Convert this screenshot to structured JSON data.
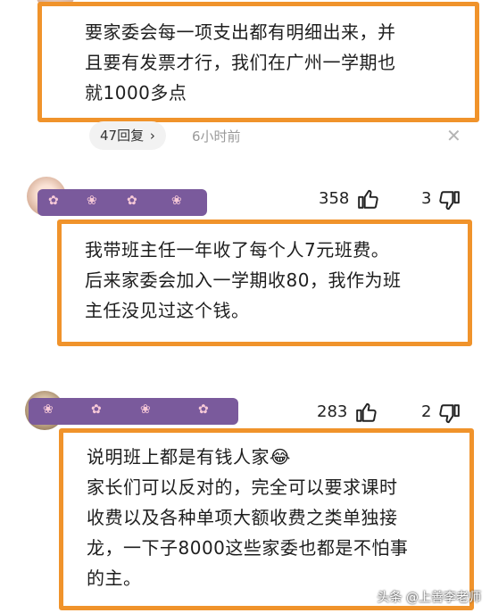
{
  "comment1": {
    "text_lines": [
      "要家委会每一项支出都有明细出来，并",
      "且要有发票才行，我们在广州一学期也",
      "就1000多点"
    ],
    "reply_label": "47回复",
    "time": "6小时前"
  },
  "comment2": {
    "likes": "358",
    "dislikes": "3",
    "text_lines": [
      "我带班主任一年收了每个人7元班费。",
      "后来家委会加入一学期收80，我作为班",
      "主任没见过这个钱。"
    ]
  },
  "comment3": {
    "likes": "283",
    "dislikes": "2",
    "text_lines": [
      "说明班上都是有钱人家😂",
      "家长们可以反对的，完全可以要求课时",
      "收费以及各种单项大额收费之类单独接",
      "龙，一下子8000这些家委也都是不怕事",
      "的主。"
    ]
  },
  "watermark": "头条 @上善李老师",
  "colors": {
    "highlight": "#f0932b",
    "mask": "#7a5a9c"
  },
  "icons": [
    "thumb-up-icon",
    "thumb-down-icon",
    "chevron-right-icon",
    "close-icon"
  ]
}
